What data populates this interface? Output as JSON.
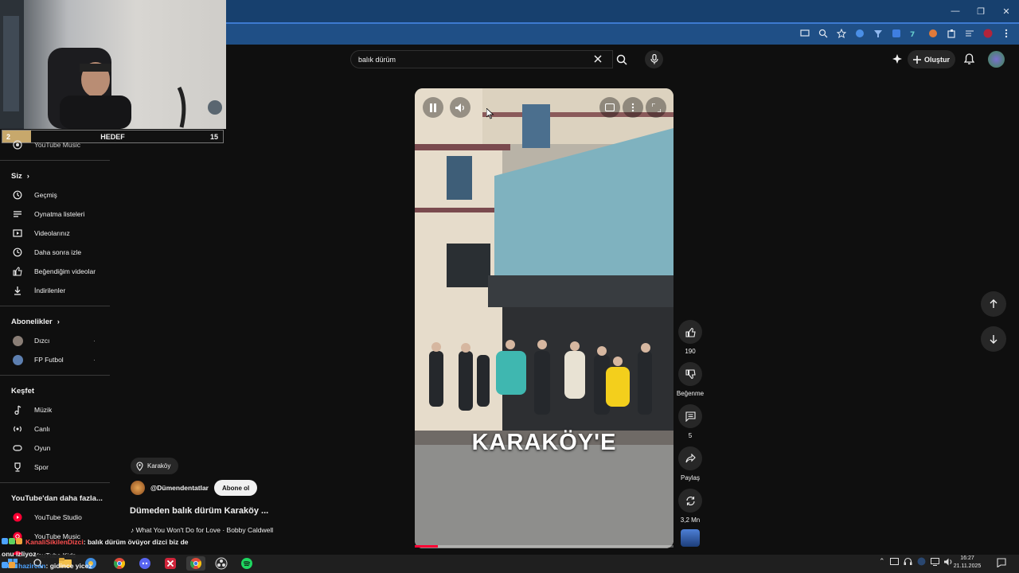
{
  "stream": {
    "goal": {
      "current": "2",
      "label": "HEDEF",
      "target": "15"
    }
  },
  "search": {
    "query": "balık dürüm"
  },
  "header": {
    "create_label": "Oluştur"
  },
  "sidebar": {
    "top_item": "YouTube Music",
    "you": {
      "heading": "Siz",
      "items": [
        "Geçmiş",
        "Oynatma listeleri",
        "Videolarınız",
        "Daha sonra izle",
        "Beğendiğim videolar",
        "İndirilenler"
      ]
    },
    "subscriptions": {
      "heading": "Abonelikler",
      "items": [
        "Dızcı",
        "FP Futbol"
      ]
    },
    "explore": {
      "heading": "Keşfet",
      "items": [
        "Müzik",
        "Canlı",
        "Oyun",
        "Spor"
      ]
    },
    "more": {
      "heading": "YouTube'dan daha fazla...",
      "items": [
        "YouTube Studio",
        "YouTube Music",
        "YouTube Kids"
      ]
    }
  },
  "short": {
    "caption": "KARAKÖY'E",
    "location": "Karaköy",
    "channel": "@Dümendentatlar",
    "subscribe_label": "Abone ol",
    "title": "Dümeden balık dürüm Karaköy ...",
    "music": "♪ What You Won't Do for Love · Bobby Caldwell",
    "progress": 0.09
  },
  "actions": {
    "likes": "190",
    "dislike_label": "Beğenme",
    "comments": "5",
    "share_label": "Paylaş",
    "remix_count": "3,2 Mn"
  },
  "chat": [
    {
      "user": "KanaliSikilenDizci",
      "message": ": balık dürüm övüyor dizci biz de"
    },
    {
      "user": "",
      "message": "onu izliyoz"
    },
    {
      "user": "hazircan",
      "message": ": gidince yicez"
    }
  ],
  "taskbar": {
    "time": "16:27",
    "date": "21.11.2025"
  },
  "colors": {
    "youtube_red": "#ff0033",
    "goal_fill": "#c7a86c",
    "chat_user": "#ff4f4f"
  }
}
